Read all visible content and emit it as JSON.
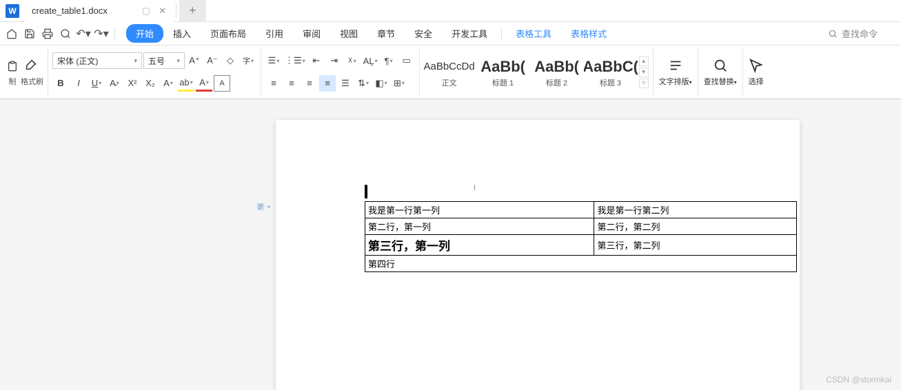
{
  "tab": {
    "title": "create_table1.docx"
  },
  "menu": [
    "开始",
    "插入",
    "页面布局",
    "引用",
    "审阅",
    "视图",
    "章节",
    "安全",
    "开发工具"
  ],
  "menu_extra": [
    "表格工具",
    "表格样式"
  ],
  "search_placeholder": "查找命令",
  "clipboard": {
    "paste": "制",
    "brush": "格式刷"
  },
  "font": {
    "name": "宋体 (正文)",
    "size": "五号"
  },
  "styles": [
    {
      "preview": "AaBbCcDd",
      "label": "正文",
      "big": false
    },
    {
      "preview": "AaBb(",
      "label": "标题 1",
      "big": true
    },
    {
      "preview": "AaBb(",
      "label": "标题 2",
      "big": true
    },
    {
      "preview": "AaBbC(",
      "label": "标题 3",
      "big": true
    }
  ],
  "tools": {
    "typography": "文字排版",
    "findreplace": "查找替换",
    "select": "选择"
  },
  "table": {
    "rows": [
      [
        {
          "t": "我是第一行第一列"
        },
        {
          "t": "我是第一行第二列"
        }
      ],
      [
        {
          "t": "第二行，第一列"
        },
        {
          "t": "第二行，第二列"
        }
      ],
      [
        {
          "t": "第三行，第一列",
          "big": true
        },
        {
          "t": "第三行，第二列"
        }
      ],
      [
        {
          "t": "第四行",
          "span": 2
        }
      ]
    ]
  },
  "watermark": "CSDN @stormkai"
}
